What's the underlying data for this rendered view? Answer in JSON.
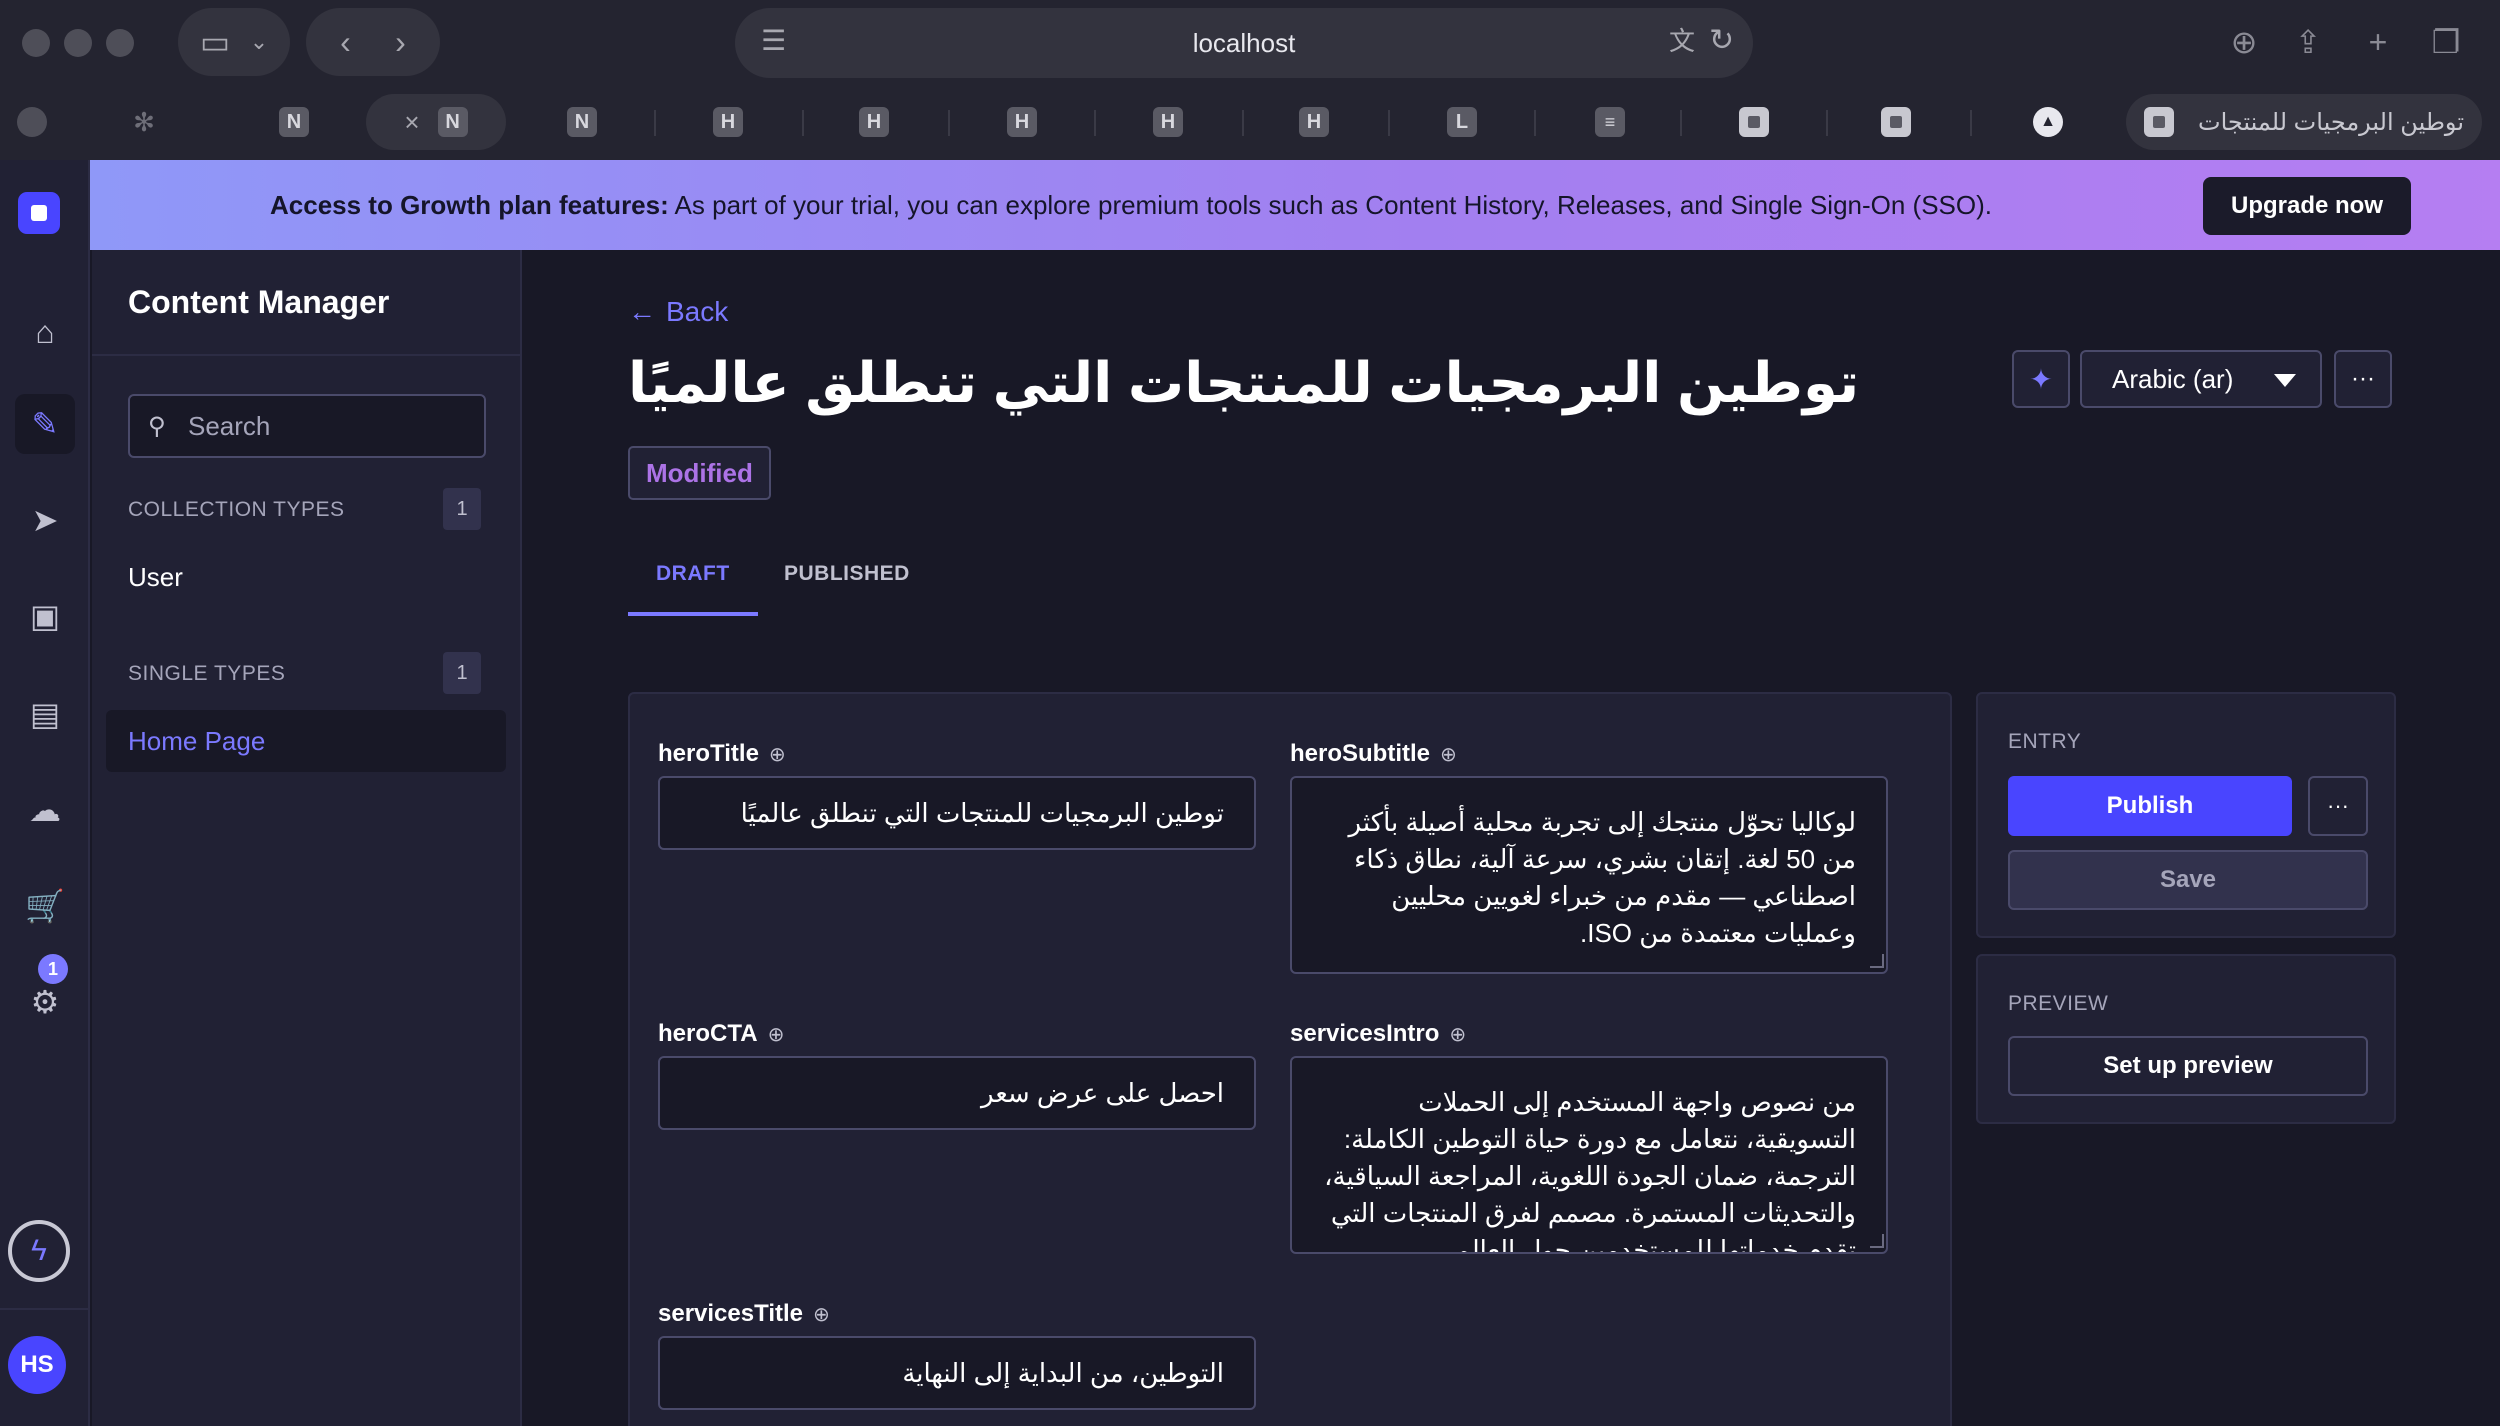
{
  "browser": {
    "url": "localhost",
    "tabs": [
      {
        "icon": "N"
      },
      {
        "icon": "N",
        "active_close": "×"
      },
      {
        "icon": "N"
      },
      {
        "icon": "H"
      },
      {
        "icon": "H"
      },
      {
        "icon": "H"
      },
      {
        "icon": "H"
      },
      {
        "icon": "H"
      },
      {
        "icon": "L"
      }
    ],
    "active_tab_title": "توطين البرمجيات للمنتجات التي تنطلق عالميًا"
  },
  "banner": {
    "title": "Access to Growth plan features:",
    "text": " As part of your trial, you can explore premium tools such as Content History, Releases, and Single Sign-On (SSO).",
    "upgrade_label": "Upgrade now",
    "close_icon": "×"
  },
  "rail": {
    "notification_count": "1",
    "avatar_initials": "HS"
  },
  "sidebar": {
    "title": "Content Manager",
    "search_placeholder": "Search",
    "collection_types_label": "COLLECTION TYPES",
    "collection_types_count": "1",
    "collection_items": [
      "User"
    ],
    "single_types_label": "SINGLE TYPES",
    "single_types_count": "1",
    "single_items": [
      "Home Page"
    ]
  },
  "main": {
    "back_label": "Back",
    "title": "توطين البرمجيات للمنتجات التي تنطلق عالميًا",
    "status": "Modified",
    "locale": "Arabic (ar)",
    "tabs": [
      {
        "label": "DRAFT"
      },
      {
        "label": "PUBLISHED"
      }
    ],
    "fields": {
      "heroTitle": {
        "label": "heroTitle",
        "value": "توطين البرمجيات للمنتجات التي تنطلق عالميًا"
      },
      "heroSubtitle": {
        "label": "heroSubtitle",
        "value": "لوكاليا تحوّل منتجك إلى تجربة محلية أصيلة بأكثر من 50 لغة. إتقان بشري، سرعة آلية، نطاق ذكاء اصطناعي — مقدم من خبراء لغويين محليين وعمليات معتمدة من ISO."
      },
      "heroCTA": {
        "label": "heroCTA",
        "value": "احصل على عرض سعر"
      },
      "servicesIntro": {
        "label": "servicesIntro",
        "value": "من نصوص واجهة المستخدم إلى الحملات التسويقية، نتعامل مع دورة حياة التوطين الكاملة: الترجمة، ضمان الجودة اللغوية، المراجعة السياقية، والتحديثات المستمرة. مصمم لفرق المنتجات التي تقدم خدماتها للمستخدمين حول العالم."
      },
      "servicesTitle": {
        "label": "servicesTitle",
        "value": "التوطين، من البداية إلى النهاية"
      }
    }
  },
  "entry": {
    "title": "ENTRY",
    "publish_label": "Publish",
    "save_label": "Save"
  },
  "preview": {
    "title": "PREVIEW",
    "button_label": "Set up preview"
  },
  "colors": {
    "primary": "#4945ff",
    "accent": "#7b79ff",
    "modified": "#ac73e6",
    "background": "#181826",
    "surface": "#212134"
  }
}
